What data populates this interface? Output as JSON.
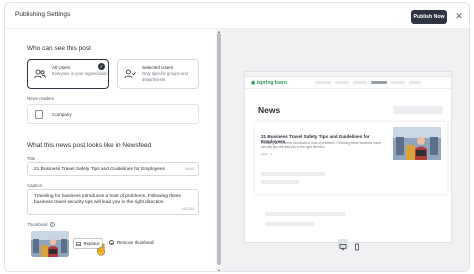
{
  "window": {
    "title": "Publishing Settings",
    "publish_label": "Publish Now"
  },
  "visibility": {
    "heading": "Who can see this post",
    "options": [
      {
        "title": "All Users",
        "desc": "Everyone in your organization",
        "selected": true
      },
      {
        "title": "Selected Users",
        "desc": "Only specific groups and departments",
        "selected": false
      }
    ],
    "readers_label": "News readers",
    "readers_value": "Company"
  },
  "newsfeed": {
    "heading": "What this news post looks like in Newsfeed",
    "title_label": "Title",
    "title_value": "21 Business Travel Safety Tips and Guidelines for Employees",
    "title_count": "59/90",
    "caption_label": "Caption",
    "caption_value": "Traveling for business introduces a host of problems. Following these business travel security tips will lead you in the right direction.",
    "caption_count": "140/150",
    "thumbnail_label": "Thumbnail",
    "replace_label": "Replace",
    "remove_label": "Remove thumbnail"
  },
  "preview": {
    "logo_text": "ispring learn",
    "news_heading": "News",
    "headline": "21 Business Travel Safety Tips and Guidelines for Employees",
    "excerpt": "Traveling for business introduces a host of problems. Following these business travel security tips will lead you in the right direction.",
    "meta": "Hello · 0"
  },
  "colors": {
    "accent": "#2f3540",
    "brand_green": "#2d9c5a",
    "preview_bg": "#f0f1f3"
  },
  "icons": [
    "close-icon",
    "users-icon",
    "user-select-icon",
    "check-icon",
    "building-icon",
    "info-icon",
    "image-icon",
    "remove-icon",
    "desktop-icon",
    "mobile-icon",
    "cursor-icon"
  ]
}
